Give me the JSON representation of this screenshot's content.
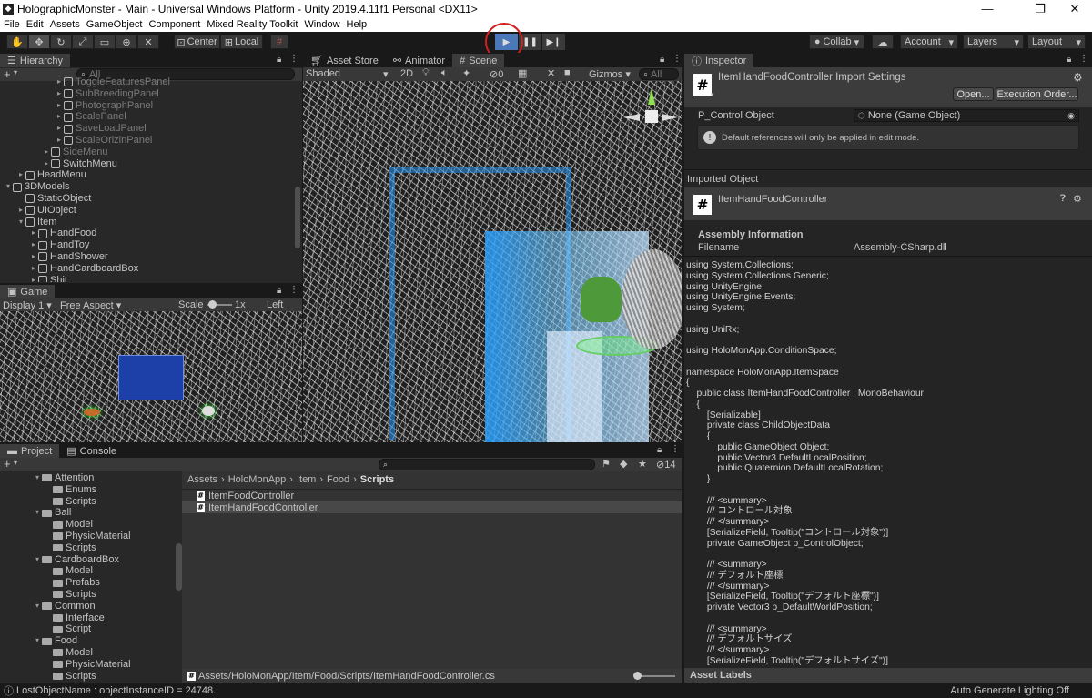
{
  "window": {
    "title": "HolographicMonster - Main - Universal Windows Platform - Unity 2019.4.11f1 Personal <DX11>",
    "icon": "unity-icon"
  },
  "menu": [
    "File",
    "Edit",
    "Assets",
    "GameObject",
    "Component",
    "Mixed Reality Toolkit",
    "Window",
    "Help"
  ],
  "toolbar": {
    "center": "Center",
    "local": "Local",
    "collab": "Collab",
    "account": "Account",
    "layers": "Layers",
    "layout": "Layout",
    "play": "▶",
    "pause": "❚❚",
    "step": "▶❙"
  },
  "hierarchy": {
    "tab": "Hierarchy",
    "add": "+",
    "search_placeholder": "All",
    "items": [
      {
        "label": "ToggleFeaturesPanel",
        "depth": 6,
        "dim": true,
        "arrow": "▸"
      },
      {
        "label": "SubBreedingPanel",
        "depth": 6,
        "dim": true,
        "arrow": "▸"
      },
      {
        "label": "PhotographPanel",
        "depth": 6,
        "dim": true,
        "arrow": "▸"
      },
      {
        "label": "ScalePanel",
        "depth": 6,
        "dim": true,
        "arrow": "▸"
      },
      {
        "label": "SaveLoadPanel",
        "depth": 6,
        "dim": true,
        "arrow": "▸"
      },
      {
        "label": "ScaleOrizinPanel",
        "depth": 6,
        "dim": true,
        "arrow": "▸"
      },
      {
        "label": "SideMenu",
        "depth": 5,
        "dim": true,
        "arrow": "▸"
      },
      {
        "label": "SwitchMenu",
        "depth": 5,
        "dim": false,
        "arrow": "▸"
      },
      {
        "label": "HeadMenu",
        "depth": 3,
        "dim": false,
        "arrow": "▸"
      },
      {
        "label": "3DModels",
        "depth": 2,
        "dim": false,
        "arrow": "▾"
      },
      {
        "label": "StaticObject",
        "depth": 3,
        "dim": false,
        "arrow": ""
      },
      {
        "label": "UIObject",
        "depth": 3,
        "dim": false,
        "arrow": "▸"
      },
      {
        "label": "Item",
        "depth": 3,
        "dim": false,
        "arrow": "▾"
      },
      {
        "label": "HandFood",
        "depth": 4,
        "dim": false,
        "arrow": "▸"
      },
      {
        "label": "HandToy",
        "depth": 4,
        "dim": false,
        "arrow": "▸"
      },
      {
        "label": "HandShower",
        "depth": 4,
        "dim": false,
        "arrow": "▸"
      },
      {
        "label": "HandCardboardBox",
        "depth": 4,
        "dim": false,
        "arrow": "▸"
      },
      {
        "label": "Shit",
        "depth": 4,
        "dim": false,
        "arrow": "▸"
      }
    ]
  },
  "game": {
    "tab": "Game",
    "display": "Display 1",
    "aspect": "Free Aspect",
    "scale_label": "Scale",
    "scale_value": "1x",
    "eye": "Left Eye"
  },
  "scene": {
    "tabs": [
      "Asset Store",
      "Animator",
      "Scene"
    ],
    "shading": "Shaded",
    "mode2d": "2D",
    "fx_count": "0",
    "gizmos": "Gizmos",
    "search_placeholder": "All"
  },
  "inspector": {
    "tab": "Inspector",
    "title": "ItemHandFoodController Import Settings",
    "open": "Open...",
    "exec_order": "Execution Order...",
    "field_label": "P_Control Object",
    "field_value": "None (Game Object)",
    "info": "Default references will only be applied in edit mode.",
    "imported_label": "Imported Object",
    "obj_name": "ItemHandFoodController",
    "assembly_header": "Assembly Information",
    "filename_label": "Filename",
    "filename_value": "Assembly-CSharp.dll",
    "code": [
      "using System.Collections;",
      "using System.Collections.Generic;",
      "using UnityEngine;",
      "using UnityEngine.Events;",
      "using System;",
      "",
      "using UniRx;",
      "",
      "using HoloMonApp.ConditionSpace;",
      "",
      "namespace HoloMonApp.ItemSpace",
      "{",
      "    public class ItemHandFoodController : MonoBehaviour",
      "    {",
      "        [Serializable]",
      "        private class ChildObjectData",
      "        {",
      "            public GameObject Object;",
      "            public Vector3 DefaultLocalPosition;",
      "            public Quaternion DefaultLocalRotation;",
      "        }",
      "",
      "        /// <summary>",
      "        /// コントロール対象",
      "        /// </summary>",
      "        [SerializeField, Tooltip(\"コントロール対象\")]",
      "        private GameObject p_ControlObject;",
      "",
      "        /// <summary>",
      "        /// デフォルト座標",
      "        /// </summary>",
      "        [SerializeField, Tooltip(\"デフォルト座標\")]",
      "        private Vector3 p_DefaultWorldPosition;",
      "",
      "        /// <summary>",
      "        /// デフォルトサイズ",
      "        /// </summary>",
      "        [SerializeField, Tooltip(\"デフォルトサイズ\")]"
    ],
    "asset_labels": "Asset Labels"
  },
  "project": {
    "tabs": [
      "Project",
      "Console"
    ],
    "add": "+",
    "hidden_count": "14",
    "tree": [
      {
        "label": "Attention",
        "depth": 1,
        "open": true
      },
      {
        "label": "Enums",
        "depth": 2,
        "open": false
      },
      {
        "label": "Scripts",
        "depth": 2,
        "open": false
      },
      {
        "label": "Ball",
        "depth": 1,
        "open": true
      },
      {
        "label": "Model",
        "depth": 2,
        "open": false
      },
      {
        "label": "PhysicMaterial",
        "depth": 2,
        "open": false
      },
      {
        "label": "Scripts",
        "depth": 2,
        "open": false
      },
      {
        "label": "CardboardBox",
        "depth": 1,
        "open": true
      },
      {
        "label": "Model",
        "depth": 2,
        "open": false
      },
      {
        "label": "Prefabs",
        "depth": 2,
        "open": false
      },
      {
        "label": "Scripts",
        "depth": 2,
        "open": false
      },
      {
        "label": "Common",
        "depth": 1,
        "open": true
      },
      {
        "label": "Interface",
        "depth": 2,
        "open": false
      },
      {
        "label": "Script",
        "depth": 2,
        "open": false
      },
      {
        "label": "Food",
        "depth": 1,
        "open": true
      },
      {
        "label": "Model",
        "depth": 2,
        "open": false
      },
      {
        "label": "PhysicMaterial",
        "depth": 2,
        "open": false
      },
      {
        "label": "Scripts",
        "depth": 2,
        "open": false
      }
    ],
    "breadcrumb": [
      "Assets",
      "HoloMonApp",
      "Item",
      "Food",
      "Scripts"
    ],
    "files": [
      "ItemFoodController",
      "ItemHandFoodController"
    ],
    "selected_path": "Assets/HoloMonApp/Item/Food/Scripts/ItemHandFoodController.cs"
  },
  "status": {
    "left": "LostObjectName : objectInstanceID = 24748.",
    "right": "Auto Generate Lighting Off"
  }
}
